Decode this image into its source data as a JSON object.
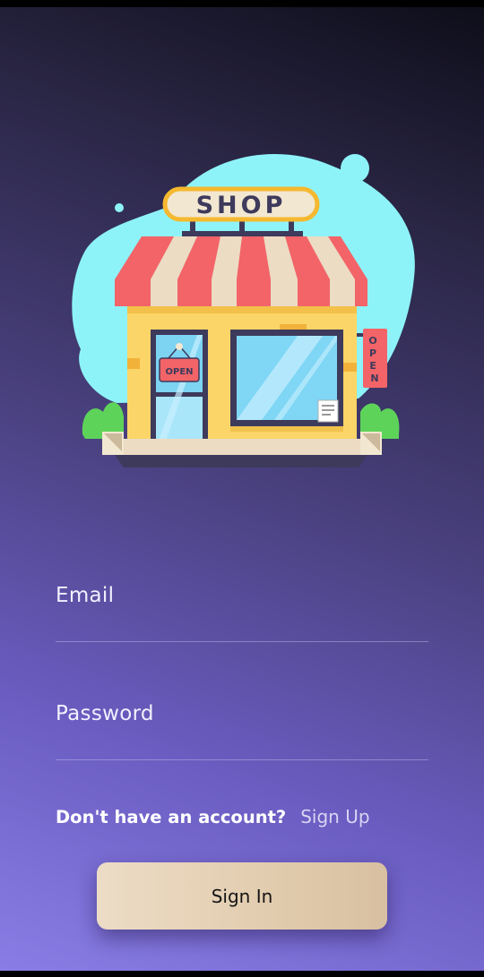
{
  "illustration": {
    "sign_text": "SHOP",
    "door_sign_text": "OPEN",
    "side_sign_letters": [
      "O",
      "P",
      "E",
      "N"
    ],
    "icon": "shop-storefront-illustration"
  },
  "login_form": {
    "email_label": "Email",
    "password_label": "Password",
    "signup_prompt": "Don't have an account?",
    "signup_link": "Sign Up",
    "signin_button": "Sign In"
  },
  "colors": {
    "background_top": "#0d0d18",
    "background_bottom": "#8a7ee6",
    "button": "#e2ccae",
    "blob": "#8ef3f8",
    "awning_red": "#f26468"
  }
}
